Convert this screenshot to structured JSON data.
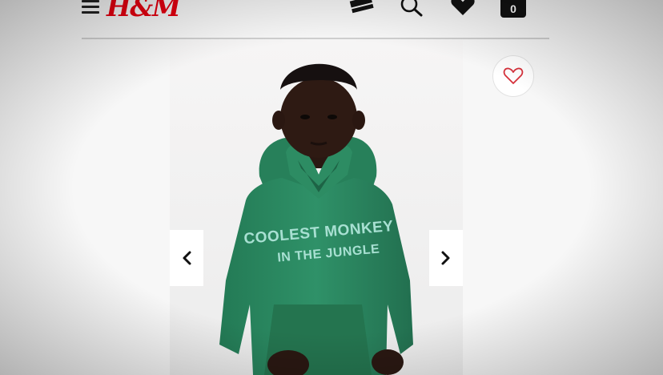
{
  "header": {
    "logo_text": "H&M",
    "cart_count": "0",
    "icons": [
      "menu-icon",
      "card-icon",
      "search-icon",
      "heart-icon",
      "shopping-bag-icon"
    ]
  },
  "product": {
    "image": "child-model-in-green-hoodie",
    "hoodie_print_line1": "COOLEST MONKEY",
    "hoodie_print_line2": "IN THE JUNGLE",
    "wishlist_icon": "heart-outline-icon",
    "prev_icon": "chevron-left-icon",
    "next_icon": "chevron-right-icon"
  },
  "colors": {
    "brand": "#e50010",
    "hoodie": "#2c8a63",
    "print": "#a8e0d2"
  }
}
